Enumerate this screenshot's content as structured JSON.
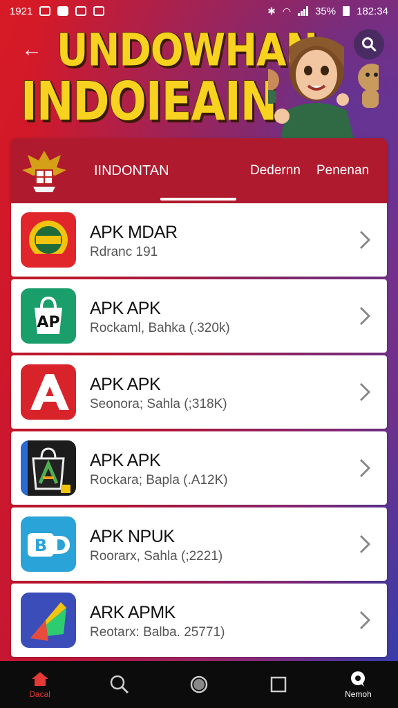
{
  "status_bar": {
    "time_left": "1921",
    "battery_pct": "35%",
    "time_right": "182:34",
    "icons": [
      "instagram-icon",
      "cloud-icon",
      "notification-icon",
      "gallery-icon",
      "bluetooth-icon",
      "wifi-icon",
      "signal-icon",
      "battery-icon"
    ]
  },
  "banner": {
    "back_icon": "arrow-left-icon",
    "title_line1": "UNDOWHAN",
    "title_line2": "INDOIEAIN",
    "search_icon": "search-icon",
    "colors": {
      "title": "#f7d21f",
      "bg_red": "#d71a25",
      "bg_blue": "#2d3fb0"
    }
  },
  "tabs": {
    "emblem_icon": "garuda-emblem-icon",
    "items": [
      {
        "label": "IINDONTAN",
        "active": true
      },
      {
        "label": "Dedernn",
        "active": false
      },
      {
        "label": "Penenan",
        "active": false
      }
    ],
    "bg_color": "#b01a2e"
  },
  "apps": [
    {
      "title": "APK MDAR",
      "subtitle": "Rdranc 191",
      "icon": "emblem-badge-icon",
      "icon_bg": "#e0262b"
    },
    {
      "title": "APK APK",
      "subtitle": "Rockaml, Bahka (.320k)",
      "icon": "shopping-bag-icon",
      "icon_bg": "#1a9e6a"
    },
    {
      "title": "APK APK",
      "subtitle": "Seonora; Sahla (;318K)",
      "icon": "letter-a-icon",
      "icon_bg": "#d9232b"
    },
    {
      "title": "APK APK",
      "subtitle": "Rockara; Bapla (.A12K)",
      "icon": "bag-a-icon",
      "icon_bg": "#1c1c1c"
    },
    {
      "title": "APK NPUK",
      "subtitle": "Roorarx, Sahla (;2221)",
      "icon": "letters-bd-icon",
      "icon_bg": "#2aa3d9"
    },
    {
      "title": "ARK APMK",
      "subtitle": "Reotarx: Balba. 25771)",
      "icon": "colorful-shape-icon",
      "icon_bg": "#3b4db8"
    }
  ],
  "bottom_nav": [
    {
      "label": "Dacal",
      "icon": "home-icon",
      "active": true
    },
    {
      "label": "",
      "icon": "search-icon"
    },
    {
      "label": "",
      "icon": "circle-home-icon"
    },
    {
      "label": "",
      "icon": "square-recents-icon"
    },
    {
      "label": "Nemoh",
      "icon": "chat-icon"
    }
  ]
}
